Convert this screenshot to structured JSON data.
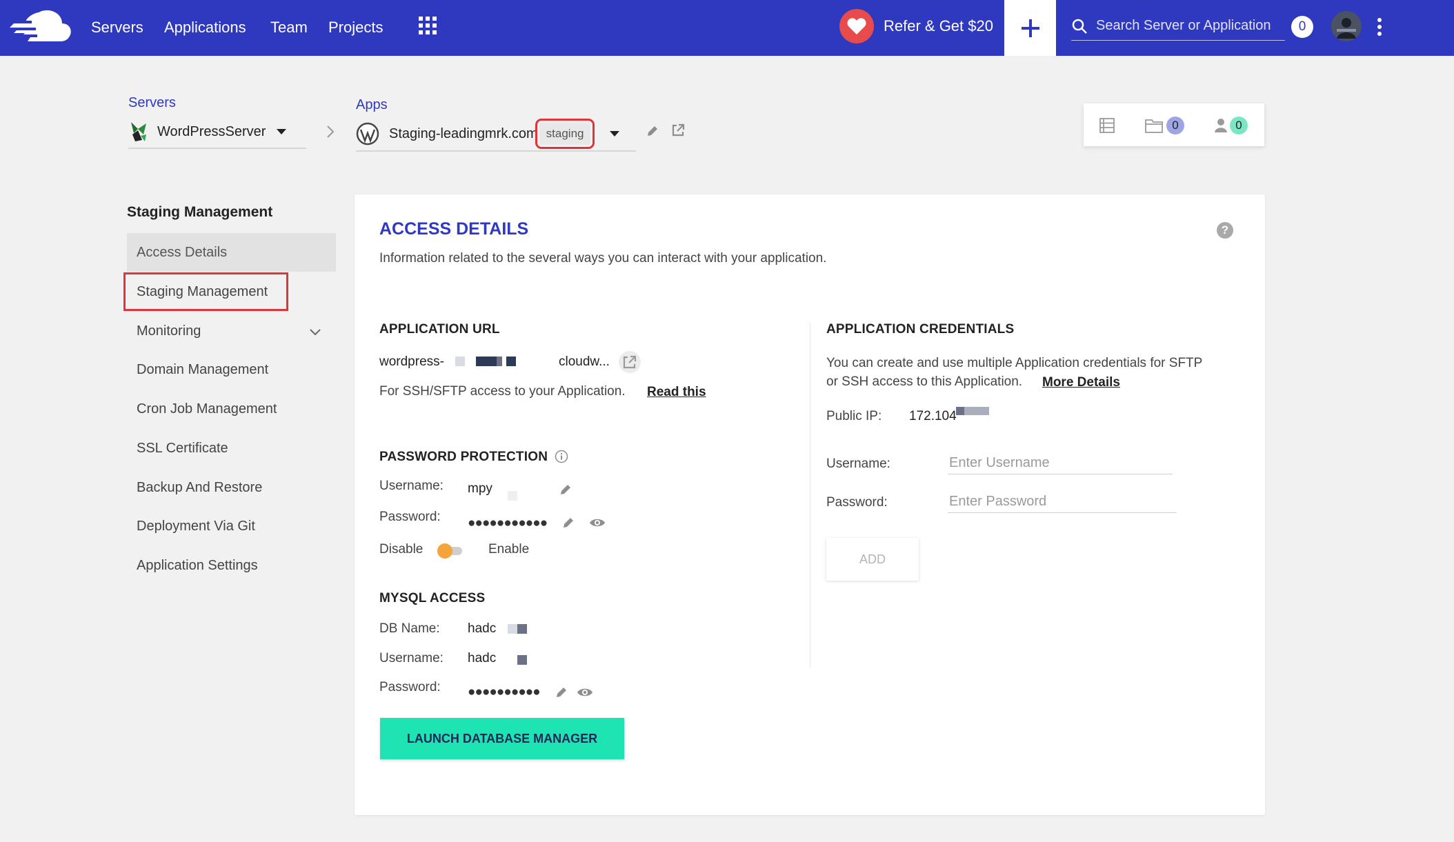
{
  "nav": {
    "links": [
      "Servers",
      "Applications",
      "Team",
      "Projects"
    ],
    "refer_label": "Refer & Get $20",
    "search_placeholder": "Search Server or Application",
    "notification_count": "0",
    "brand_color": "#2f39bf"
  },
  "breadcrumb": {
    "servers_label": "Servers",
    "server_name": "WordPressServer",
    "apps_label": "Apps",
    "app_name": "Staging-leadingmrk.com",
    "app_tag": "staging"
  },
  "stats": {
    "folder_count": "0",
    "users_count": "0"
  },
  "sidebar": {
    "title": "Staging Management",
    "items": [
      "Access Details",
      "Staging Management",
      "Monitoring",
      "Domain Management",
      "Cron Job Management",
      "SSL Certificate",
      "Backup And Restore",
      "Deployment Via Git",
      "Application Settings"
    ]
  },
  "access": {
    "title": "ACCESS DETAILS",
    "description": "Information related to the several ways you can interact with your application.",
    "app_url": {
      "title": "APPLICATION URL",
      "url_prefix": "wordpress-",
      "url_suffix": "cloudw...",
      "ssh_text": "For SSH/SFTP access to your Application.",
      "read_this": "Read this"
    },
    "password_protection": {
      "title": "PASSWORD PROTECTION",
      "username_label": "Username:",
      "username_value": "mpy",
      "password_label": "Password:",
      "password_value": "●●●●●●●●●●●",
      "disable_label": "Disable",
      "enable_label": "Enable"
    },
    "mysql": {
      "title": "MYSQL ACCESS",
      "db_name_label": "DB Name:",
      "db_name_value": "hadc",
      "username_label": "Username:",
      "username_value": "hadc",
      "password_label": "Password:",
      "password_value": "●●●●●●●●●●",
      "launch_button": "LAUNCH DATABASE MANAGER"
    },
    "credentials": {
      "title": "APPLICATION CREDENTIALS",
      "description_line1": "You can create and use multiple Application credentials for SFTP",
      "description_line2": "or SSH access to this Application.",
      "more_details": "More Details",
      "public_ip_label": "Public IP:",
      "public_ip_value": "172.104",
      "username_label": "Username:",
      "username_placeholder": "Enter Username",
      "password_label": "Password:",
      "password_placeholder": "Enter Password",
      "add_button": "ADD"
    }
  }
}
